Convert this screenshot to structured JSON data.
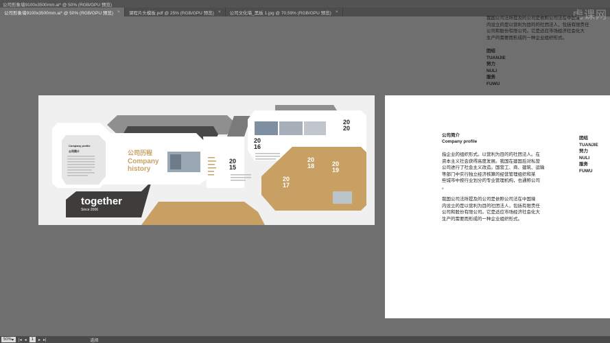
{
  "window": {
    "title": "公司形象墙9100x3500mm.ai* @ 50% (RGB/GPU 预览)"
  },
  "tabs": [
    {
      "label": "公司形象墙9100x3500mm.ai* @ 50% (RGB/GPU 预览)",
      "active": true
    },
    {
      "label": "课程片头模板.pdf @ 25% (RGB/GPU 预览)",
      "active": false
    },
    {
      "label": "公司文化墙_黑板 1.jpg @ 70.59% (RGB/GPU 预览)",
      "active": false
    }
  ],
  "watermark": "虎课网",
  "statusbar": {
    "zoom": "50%",
    "page": "1",
    "tool": "选择"
  },
  "overflow_text": {
    "para": [
      "我国公司法所提及的公司是依照公司法在中国境",
      "内设立的是以营利为目的的社团法人，包括有限责任",
      "公司和股份有限公司。它是适应市场经济社会化大",
      "生产的需要而形成的一种企业组织形式。"
    ],
    "keywords": [
      "团结",
      "TUANJIE",
      "努力",
      "NULI",
      "服务",
      "FUWU"
    ]
  },
  "design": {
    "profile_title": "Company profile",
    "profile_cn": "公司简介",
    "history_cn": "公司历程",
    "history_en1": "Company",
    "history_en2": "history",
    "together": "together",
    "since": "Since 2006",
    "years": [
      "20",
      "15",
      "20",
      "16",
      "20",
      "20",
      "20",
      "18",
      "20",
      "19",
      "20",
      "17"
    ],
    "colors": {
      "gold": "#c9a063",
      "dark": "#3d3b3a",
      "grey": "#8a8a8a"
    }
  },
  "right_page": {
    "title_cn": "公司简介",
    "title_en": "Company profile",
    "para1": [
      "指企业的组织形式。以营利为目的的社团法人。在",
      "资本主义社会获得高度发展。我国在建国后对私营",
      "公司进行了社会主义改造。国营工、商、建筑、运输",
      "等部门中实行独立经济核算的经营管理组织和某",
      "些城市中按行业划分的专业管理机构，也通称公司",
      "。"
    ],
    "para2": [
      "我国公司法所提及的公司是依照公司法在中国境",
      "内设立的是以营利为目的社团法人，包括有限责任",
      "公司和股份有限公司。它是适应市场经济社会化大",
      "生产的需要而形成的一种企业组织形式。"
    ],
    "keywords": [
      "团结",
      "TUANJIE",
      "努力",
      "NULI",
      "服务",
      "FUWU"
    ]
  }
}
